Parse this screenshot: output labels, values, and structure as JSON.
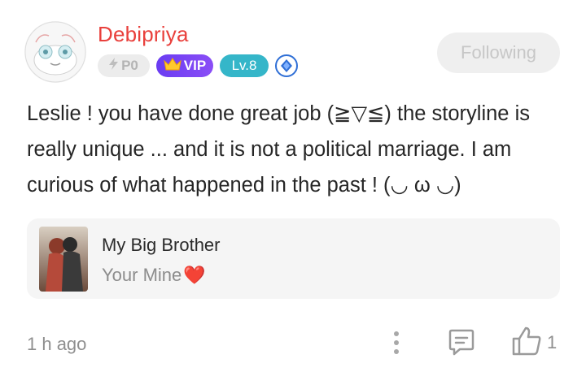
{
  "user": {
    "name": "Debipriya",
    "badges": {
      "power": "P0",
      "vip": "VIP",
      "level": "Lv.8"
    }
  },
  "follow_button": {
    "label": "Following"
  },
  "comment": {
    "text": "Leslie ! you have done great job (≧▽≦) the storyline is really unique ... and it is not a political marriage. I am curious of what happened in the past ! (◡ ω ◡)"
  },
  "book": {
    "title": "My Big Brother",
    "subtitle": "Your Mine",
    "subtitle_emoji": "❤️"
  },
  "footer": {
    "timestamp": "1 h ago",
    "like_count": "1"
  },
  "colors": {
    "username": "#e9403c",
    "vip_badge": "#7a45f4",
    "level_badge": "#35b6c9",
    "follow_button_bg": "#efefef"
  },
  "icons": [
    "avatar",
    "lightning-icon",
    "crown-icon",
    "gem-icon",
    "more-icon",
    "reply-icon",
    "thumbs-up-icon"
  ]
}
